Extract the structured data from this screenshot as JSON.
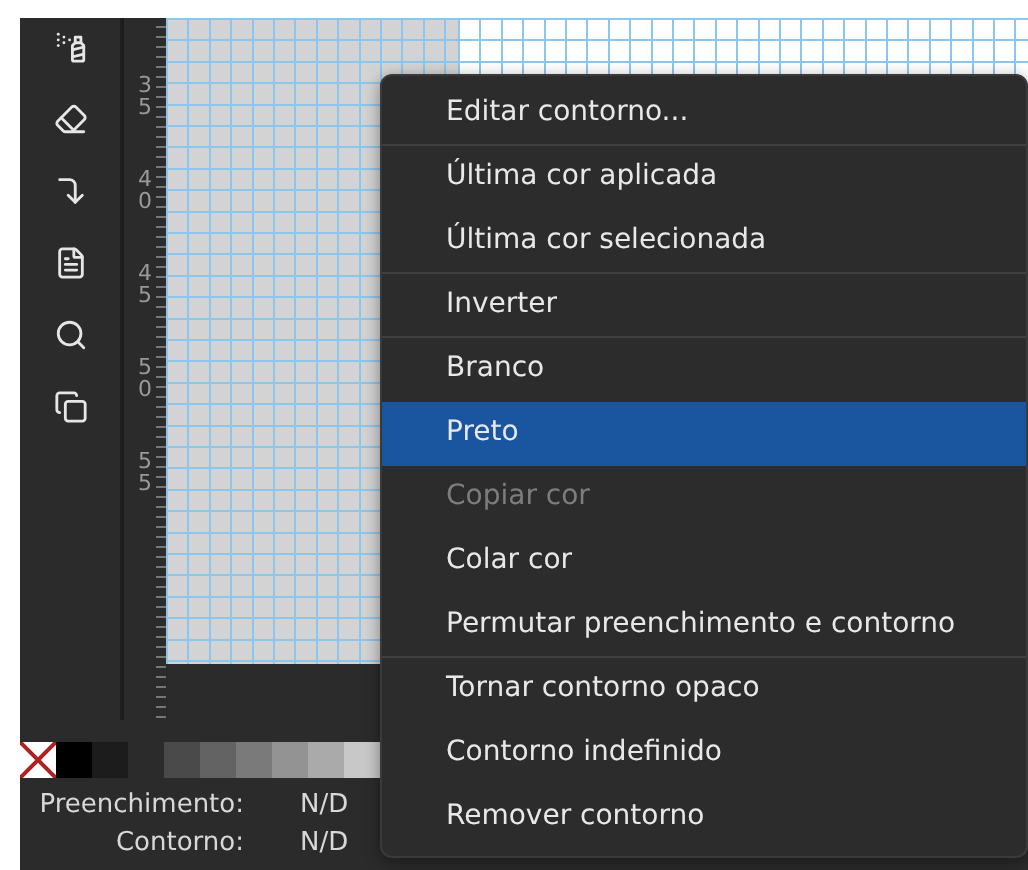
{
  "toolbar": {
    "tools": [
      {
        "kind": "spray"
      },
      {
        "kind": "eraser"
      },
      {
        "kind": "connector"
      },
      {
        "kind": "document"
      },
      {
        "kind": "zoom"
      },
      {
        "kind": "copy"
      }
    ]
  },
  "ruler": {
    "labels": [
      "35",
      "40",
      "45",
      "50",
      "55"
    ]
  },
  "palette": {
    "swatches": [
      {
        "kind": "none"
      },
      {
        "color": "#000000"
      },
      {
        "color": "#1c1c1c"
      },
      {
        "kind": "gap"
      },
      {
        "color": "#4a4a4a"
      },
      {
        "color": "#636363"
      },
      {
        "color": "#7a7a7a"
      },
      {
        "color": "#939393"
      },
      {
        "color": "#aaaaaa"
      },
      {
        "color": "#c8c8c8"
      }
    ]
  },
  "status": [
    {
      "label": "Preenchimento:",
      "value": "N/D"
    },
    {
      "label": "Contorno:",
      "value": "N/D"
    }
  ],
  "context_menu": {
    "items": [
      {
        "label": "Editar contorno...",
        "selected": false,
        "disabled": false,
        "separator_after": true
      },
      {
        "label": "Última cor aplicada",
        "selected": false,
        "disabled": false,
        "separator_after": false
      },
      {
        "label": "Última cor selecionada",
        "selected": false,
        "disabled": false,
        "separator_after": true
      },
      {
        "label": "Inverter",
        "selected": false,
        "disabled": false,
        "separator_after": true
      },
      {
        "label": "Branco",
        "selected": false,
        "disabled": false,
        "separator_after": false
      },
      {
        "label": "Preto",
        "selected": true,
        "disabled": false,
        "separator_after": false
      },
      {
        "label": "Copiar cor",
        "selected": false,
        "disabled": true,
        "separator_after": false
      },
      {
        "label": "Colar cor",
        "selected": false,
        "disabled": false,
        "separator_after": false
      },
      {
        "label": "Permutar preenchimento e contorno",
        "selected": false,
        "disabled": false,
        "separator_after": true
      },
      {
        "label": "Tornar contorno opaco",
        "selected": false,
        "disabled": false,
        "separator_after": false
      },
      {
        "label": "Contorno indefinido",
        "selected": false,
        "disabled": false,
        "separator_after": false
      },
      {
        "label": "Remover contorno",
        "selected": false,
        "disabled": false,
        "separator_after": false
      }
    ]
  }
}
